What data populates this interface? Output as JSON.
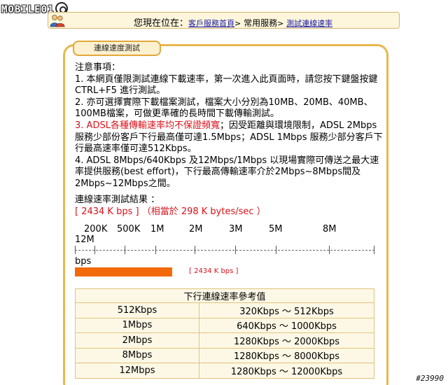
{
  "watermark": {
    "logo_text": "MOBILE01"
  },
  "breadcrumb": {
    "lead": "您現在位在：",
    "link1": "客戶服務首頁",
    "sep1": ">",
    "middle": "常用服務",
    "sep2": ">",
    "link2": "測試連線速率"
  },
  "panel": {
    "tab_title": "連線速度測試",
    "notes_heading": "注意事項：",
    "note1": "1. 本網頁僅限測試連線下載速率，第一次進入此頁面時，請您按下鍵盤按鍵 CTRL+F5 進行測試。",
    "note2": "2. 亦可選擇實際下載檔案測試，檔案大小分別為10MB、20MB、40MB、100MB檔案，可做更準確的長時間下載傳輸測試。",
    "note3_prefix": "3. ",
    "note3_red": "ADSL各種傳輸速率均不保證頻寬",
    "note3_rest": "；因受距離與環境限制，ADSL 2Mbps 服務少部份客戶下行最高僅可達1.5Mbps；ADSL 1Mbps 服務少部分客戶下行最高速率僅可達512Kbps。",
    "note4": "4. ADSL 8Mbps/640Kbps 及12Mbps/1Mbps 以現場實際可傳送之最大速率提供服務(best effort)，下行最高傳輸速率介於2Mbps~8Mbps間及2Mbps~12Mbps之間。",
    "result_title": "連線速率測試結果 ：",
    "result_value": "[ 2434 K bps ] （相當於 298 K bytes/sec ）"
  },
  "speed_scale": {
    "labels": [
      "200K",
      "500K",
      "1M",
      "2M",
      "3M",
      "5M",
      "8M",
      "12M"
    ],
    "unit": "bps",
    "measured_kbps": 2434,
    "bar_label": "[ 2434 K bps ]",
    "bar_color": "#f26a0a"
  },
  "reference_table": {
    "header": "下行連線速率參考值",
    "rows": [
      {
        "plan": "512Kbps",
        "range": "320Kbps ～ 512Kbps"
      },
      {
        "plan": "1Mbps",
        "range": "640Kbps ～ 1000Kbps"
      },
      {
        "plan": "2Mbps",
        "range": "1280Kbps ～ 2000Kbps"
      },
      {
        "plan": "8Mbps",
        "range": "1280Kbps ～ 8000Kbps"
      },
      {
        "plan": "12Mbps",
        "range": "1280Kbps ～ 12000Kbps"
      }
    ]
  },
  "footer": {
    "tag": "#23990"
  },
  "colors": {
    "accent_border": "#e7b84c",
    "highlight_red": "#d8121b",
    "table_bg": "#fdf8e6"
  }
}
